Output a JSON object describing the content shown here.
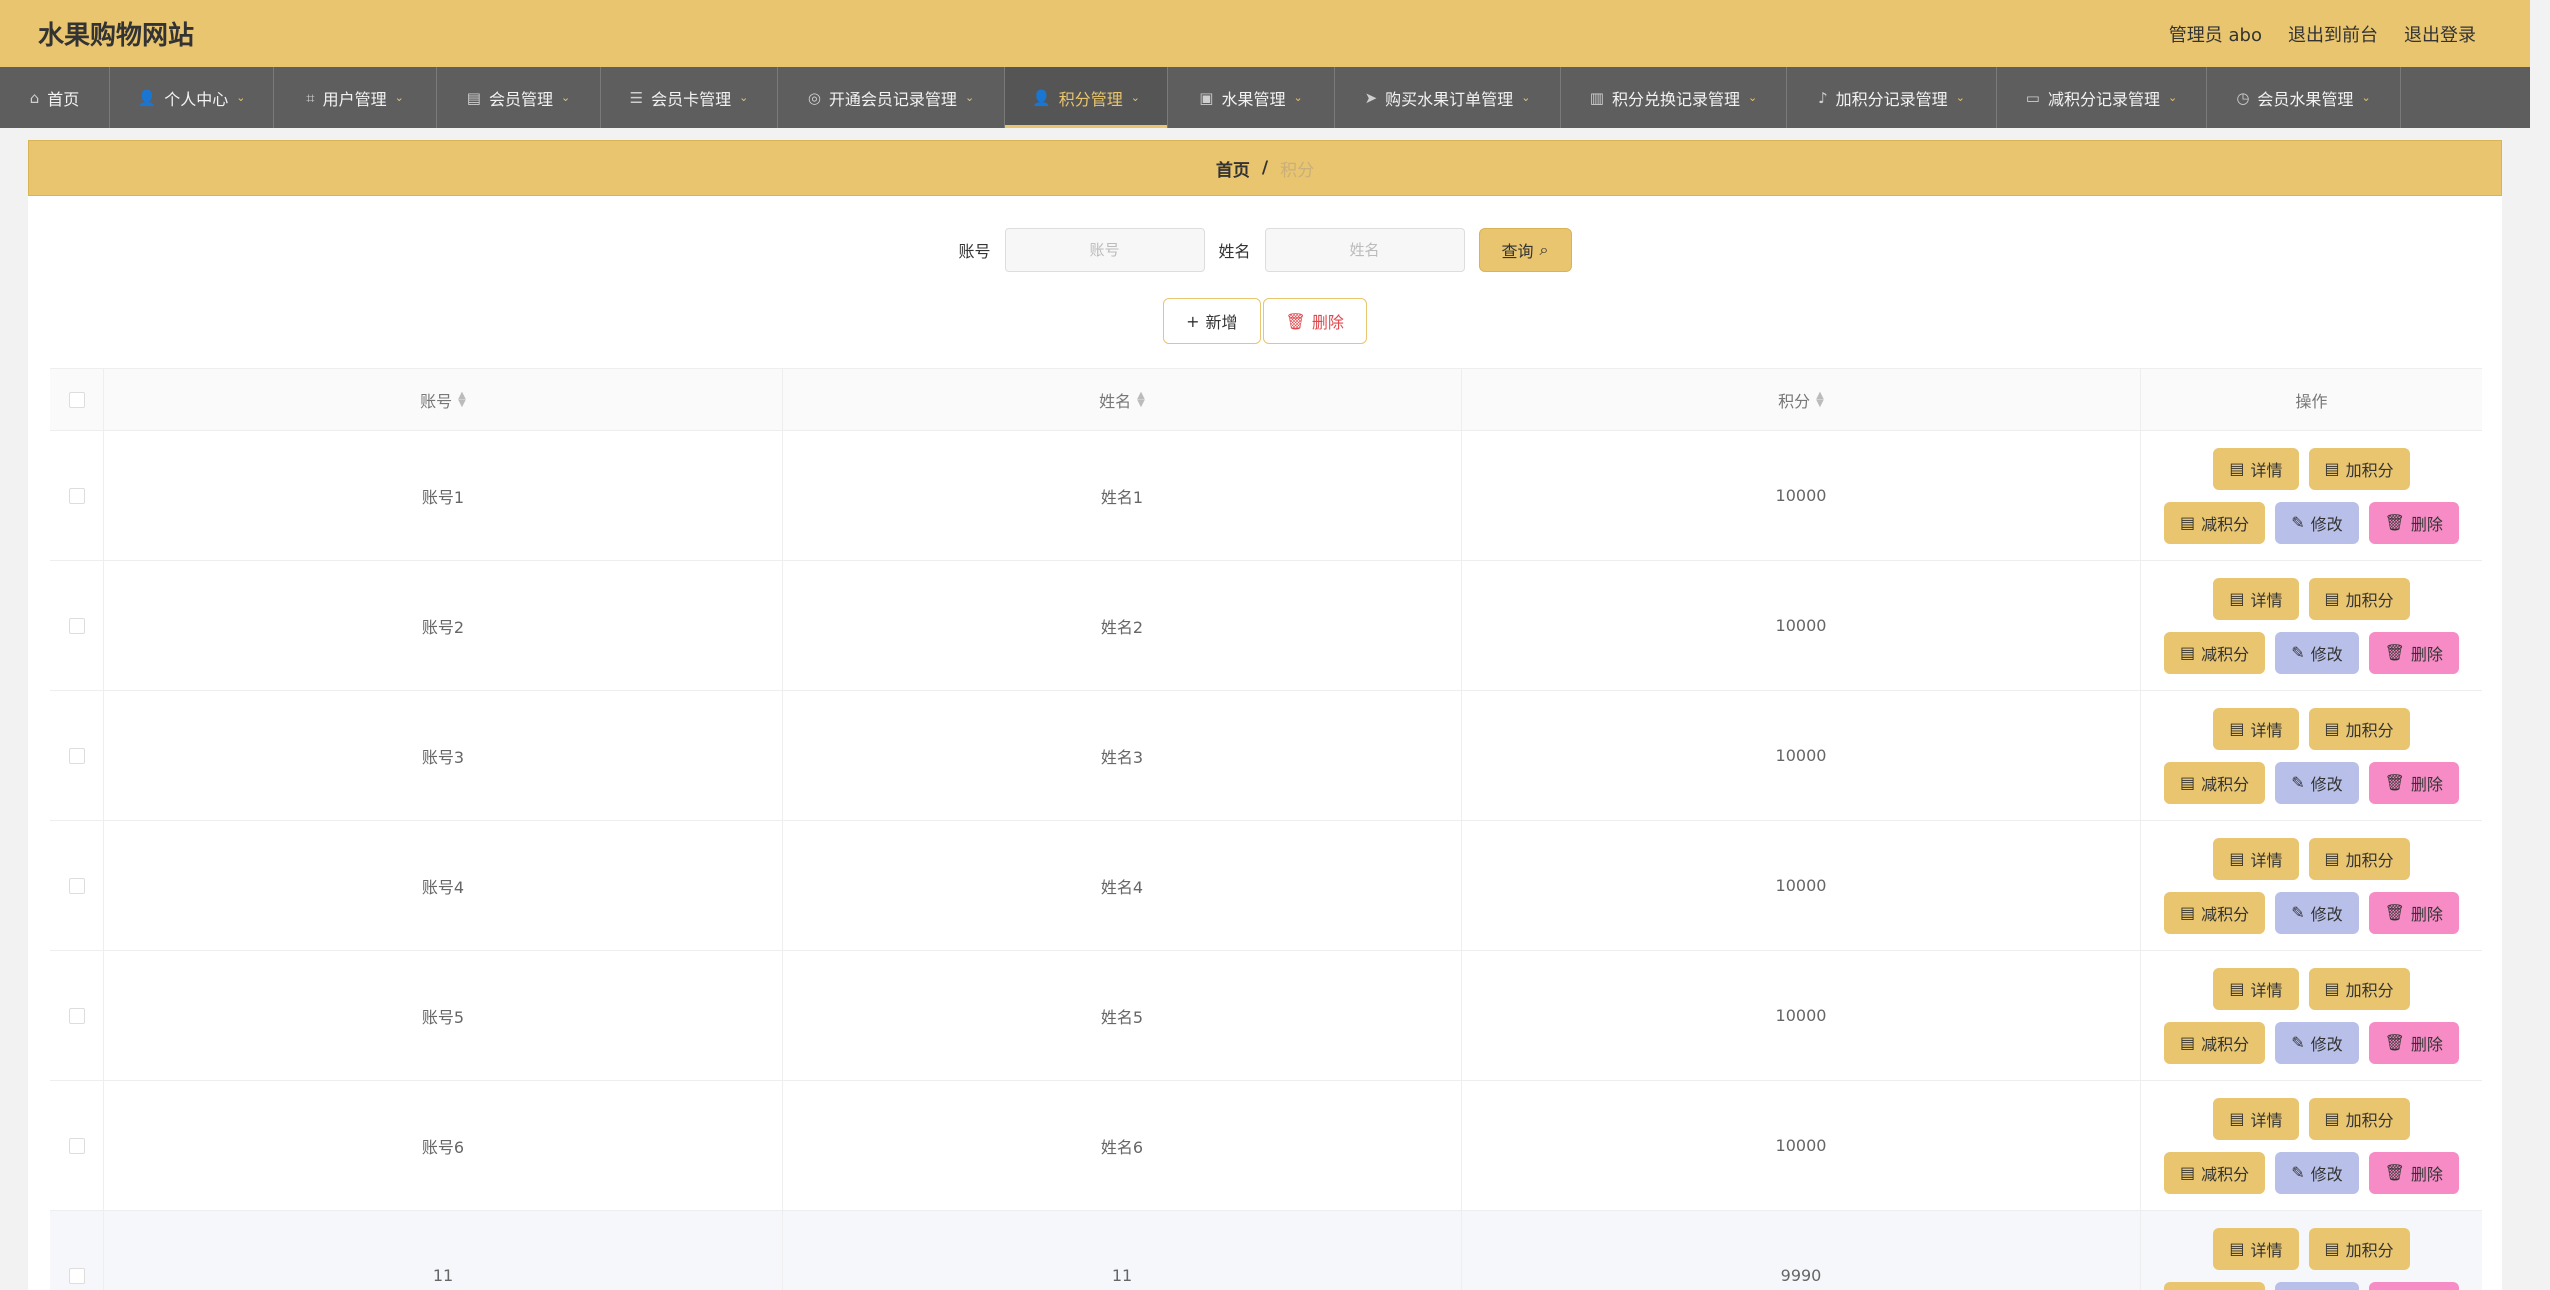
{
  "header": {
    "title": "水果购物网站",
    "admin": "管理员 abo",
    "to_front": "退出到前台",
    "logout": "退出登录"
  },
  "nav": {
    "items": [
      {
        "label": "首页",
        "icon": "home-icon",
        "glyph": "⌂",
        "caret": false,
        "width": 110
      },
      {
        "label": "个人中心",
        "icon": "user-icon",
        "glyph": "👤",
        "caret": true,
        "width": 164
      },
      {
        "label": "用户管理",
        "icon": "crop-icon",
        "glyph": "⌗",
        "caret": true,
        "width": 163
      },
      {
        "label": "会员管理",
        "icon": "clipboard-icon",
        "glyph": "▤",
        "caret": true,
        "width": 164
      },
      {
        "label": "会员卡管理",
        "icon": "sliders-icon",
        "glyph": "☰",
        "caret": true,
        "width": 177
      },
      {
        "label": "开通会员记录管理",
        "icon": "compass-icon",
        "glyph": "◎",
        "caret": true,
        "width": 227
      },
      {
        "label": "积分管理",
        "icon": "user-icon",
        "glyph": "👤",
        "caret": true,
        "width": 163,
        "active": true
      },
      {
        "label": "水果管理",
        "icon": "briefcase-icon",
        "glyph": "▣",
        "caret": true,
        "width": 167
      },
      {
        "label": "购买水果订单管理",
        "icon": "send-icon",
        "glyph": "➤",
        "caret": true,
        "width": 226
      },
      {
        "label": "积分兑换记录管理",
        "icon": "chart-icon",
        "glyph": "▥",
        "caret": true,
        "width": 226
      },
      {
        "label": "加积分记录管理",
        "icon": "mic-icon",
        "glyph": "♪",
        "caret": true,
        "width": 210
      },
      {
        "label": "减积分记录管理",
        "icon": "monitor-icon",
        "glyph": "▭",
        "caret": true,
        "width": 210
      },
      {
        "label": "会员水果管理",
        "icon": "clock-icon",
        "glyph": "◷",
        "caret": true,
        "width": 194
      }
    ]
  },
  "breadcrumb": {
    "home": "首页",
    "sep": "/",
    "current": "积分"
  },
  "search": {
    "account_label": "账号",
    "account_placeholder": "账号",
    "name_label": "姓名",
    "name_placeholder": "姓名",
    "query_label": "查询"
  },
  "actions": {
    "add_label": "新增",
    "delete_label": "删除"
  },
  "table": {
    "headers": {
      "account": "账号",
      "name": "姓名",
      "score": "积分",
      "ops": "操作"
    },
    "ops": {
      "detail": "详情",
      "add_score": "加积分",
      "sub_score": "减积分",
      "edit": "修改",
      "delete": "删除"
    },
    "rows": [
      {
        "account": "账号1",
        "name": "姓名1",
        "score": "10000"
      },
      {
        "account": "账号2",
        "name": "姓名2",
        "score": "10000"
      },
      {
        "account": "账号3",
        "name": "姓名3",
        "score": "10000"
      },
      {
        "account": "账号4",
        "name": "姓名4",
        "score": "10000"
      },
      {
        "account": "账号5",
        "name": "姓名5",
        "score": "10000"
      },
      {
        "account": "账号6",
        "name": "姓名6",
        "score": "10000"
      },
      {
        "account": "11",
        "name": "11",
        "score": "9990"
      }
    ]
  },
  "colors": {
    "accent": "#e8c56e",
    "nav_bg": "#5e5e5e",
    "edit": "#b8c0ea",
    "delete": "#f78bc6"
  }
}
